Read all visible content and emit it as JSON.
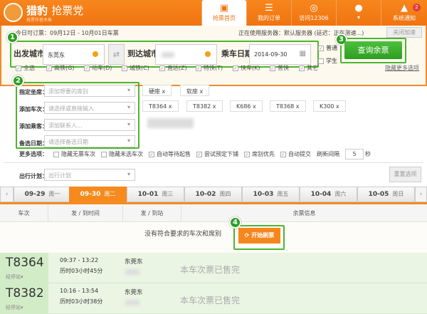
{
  "app": {
    "name": "猎豹",
    "name2": "抢票党",
    "subtitle": "抢票作者木鱼"
  },
  "nav": [
    {
      "label": "抢票首页",
      "icon": "bus-icon"
    },
    {
      "label": "我的订单",
      "icon": "order-icon"
    },
    {
      "label": "访问12306",
      "icon": "globe-icon"
    },
    {
      "label": "",
      "icon": "user-icon"
    },
    {
      "label": "系统通知",
      "icon": "bell-icon",
      "badge": "2"
    }
  ],
  "info": {
    "bookable": "今日可订票：09月12日 - 10月01日车票",
    "server": "正在使用服务器：默认服务器 (延迟：正在测速...)",
    "close_accel": "关闭加速"
  },
  "search": {
    "from_label": "出发城市",
    "from_value": "东莞东",
    "to_label": "到达城市",
    "date_label": "乘车日期",
    "date_value": "2014-09-30",
    "normal": "普通",
    "student": "学生",
    "query": "查询余票"
  },
  "filters": [
    "全选",
    "高铁(G)",
    "动车(D)",
    "城铁(C)",
    "直达(Z)",
    "特快(T)",
    "快车(K)",
    "普快",
    "其它"
  ],
  "hide_more": "隐藏更多选项",
  "form": {
    "seat_label": "指定坐席：",
    "seat_ph": "添加想要的席别",
    "train_label": "添加车次：",
    "train_ph": "请选择或直接输入",
    "passenger_label": "添加乘客：",
    "passenger_ph": "添加联系人...",
    "alt_label": "备选日期：",
    "alt_ph": "请选择备选日期",
    "seats": [
      "硬座 x",
      "软座 x"
    ],
    "trains": [
      "T8364 x",
      "T8382 x",
      "K686 x",
      "T8368 x",
      "K300 x"
    ]
  },
  "more": {
    "label": "更多选项：",
    "opts": [
      "隐藏无票车次",
      "隐藏未选车次",
      "自动等待起售",
      "尝试预定下铺",
      "席别优先",
      "自动提交"
    ],
    "refresh": "刷新间隔",
    "interval": "5",
    "unit": "秒"
  },
  "plan": {
    "label": "出行计划：",
    "ph": "出行计划",
    "reset": "重置选项"
  },
  "dates": [
    {
      "d": "09-29",
      "w": "周一"
    },
    {
      "d": "09-30",
      "w": "周二"
    },
    {
      "d": "10-01",
      "w": "周三"
    },
    {
      "d": "10-02",
      "w": "周四"
    },
    {
      "d": "10-03",
      "w": "周五"
    },
    {
      "d": "10-04",
      "w": "周六"
    },
    {
      "d": "10-05",
      "w": "周日"
    }
  ],
  "cols": [
    "车次",
    "发 / 到时间",
    "发 / 到站",
    "余票信息"
  ],
  "empty_msg": "没有符合要求的车次和席别",
  "start": "开始刷票",
  "rows": [
    {
      "train": "T8364",
      "stops": "经停站",
      "time": "09:37 - 13:22",
      "dur": "历时03小时45分",
      "station": "东莞东",
      "status": "本车次票已售完"
    },
    {
      "train": "T8382",
      "stops": "经停站",
      "time": "10:16 - 13:54",
      "dur": "历时03小时38分",
      "station": "东莞东",
      "status": "本车次票已售完"
    }
  ],
  "badges": [
    "1",
    "2",
    "3",
    "4"
  ]
}
